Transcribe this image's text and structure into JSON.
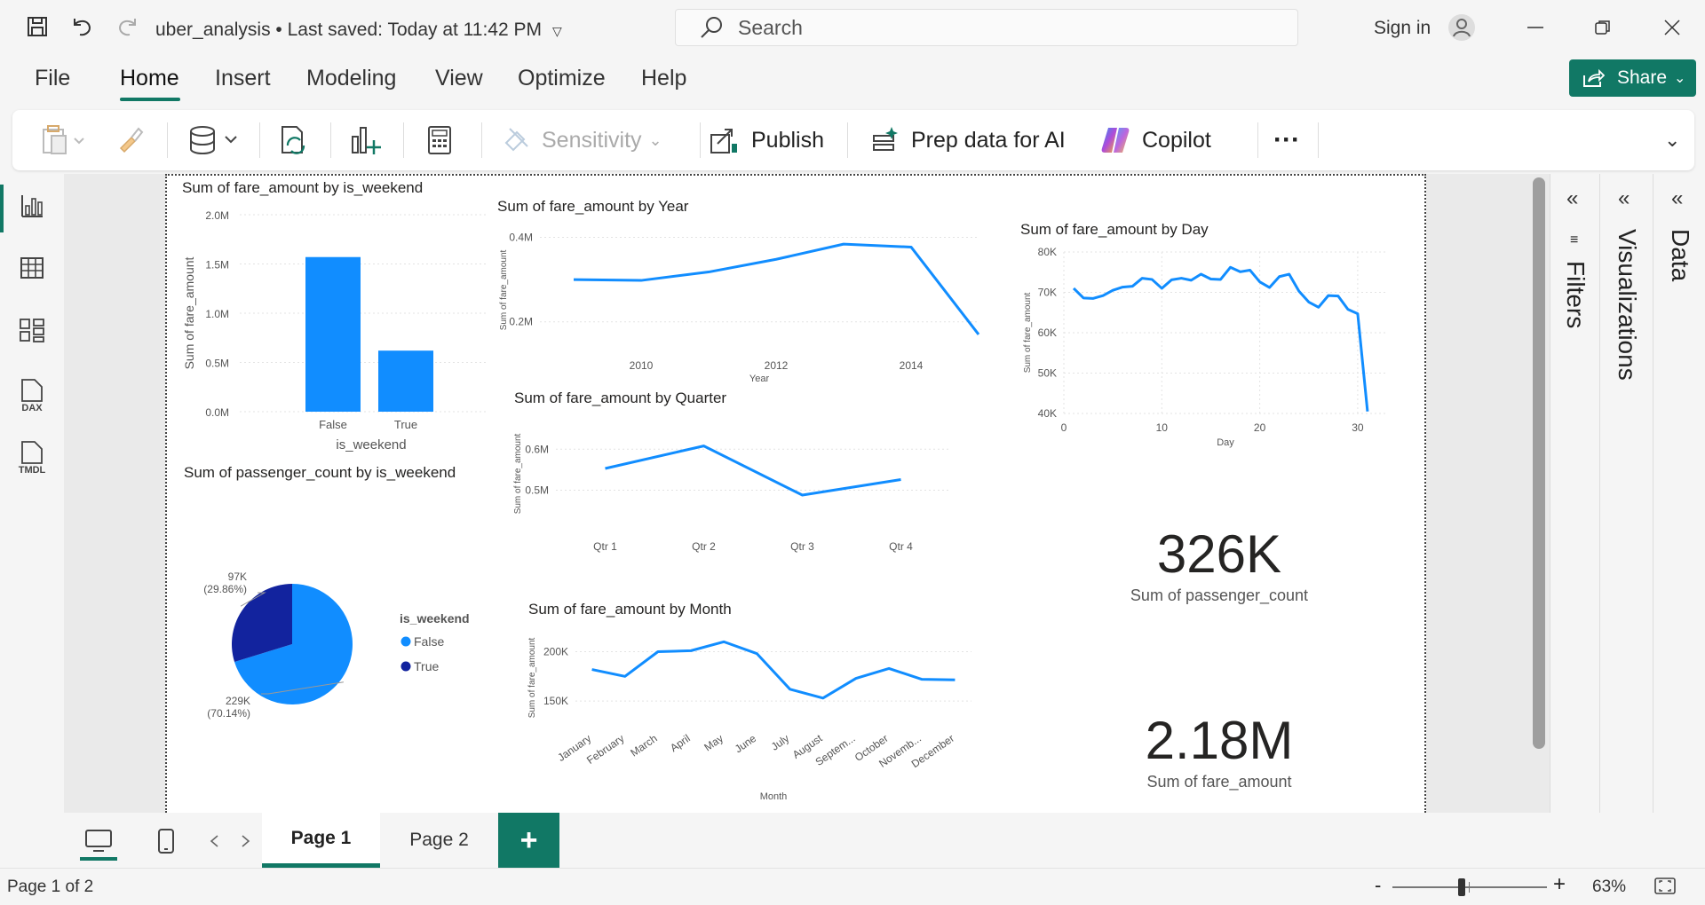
{
  "titlebar": {
    "doc_title": "uber_analysis • Last saved: Today at 11:42 PM",
    "search_placeholder": "Search",
    "signin": "Sign in"
  },
  "menu": [
    "File",
    "Home",
    "Insert",
    "Modeling",
    "View",
    "Optimize",
    "Help"
  ],
  "share_label": "Share",
  "ribbon": {
    "sensitivity": "Sensitivity",
    "publish": "Publish",
    "prep_ai": "Prep data for AI",
    "copilot": "Copilot",
    "more": "···"
  },
  "rail_icons": [
    "report-view-icon",
    "table-view-icon",
    "model-view-icon",
    "dax-query-icon",
    "tmdl-view-icon"
  ],
  "rail_labels": {
    "dax": "DAX",
    "tmdl": "TMDL"
  },
  "panes": {
    "filters": "Filters",
    "visualizations": "Visualizations",
    "data": "Data"
  },
  "tabs": [
    "Page 1",
    "Page 2"
  ],
  "add_tab": "+",
  "status": {
    "page_info": "Page 1 of 2",
    "zoom": "63%",
    "zoom_level": 0.45
  },
  "colors": {
    "accent": "#117865",
    "bar": "#118DFF",
    "dark_series": "#12239E"
  },
  "chart_data": [
    {
      "id": "bar_weekend",
      "type": "bar",
      "title": "Sum of fare_amount by is_weekend",
      "xlabel": "is_weekend",
      "ylabel": "Sum of fare_amount",
      "categories": [
        "False",
        "True"
      ],
      "values": [
        1570000,
        620000
      ],
      "ylim": [
        0,
        2000000
      ],
      "yticks": [
        0,
        500000,
        1000000,
        1500000,
        2000000
      ],
      "ytick_labels": [
        "0.0M",
        "0.5M",
        "1.0M",
        "1.5M",
        "2.0M"
      ]
    },
    {
      "id": "line_year",
      "type": "line",
      "title": "Sum of fare_amount by Year",
      "xlabel": "Year",
      "ylabel": "Sum of fare_amount",
      "x": [
        2009,
        2010,
        2011,
        2012,
        2013,
        2014,
        2015
      ],
      "values": [
        300000,
        298000,
        318000,
        348000,
        384000,
        377000,
        170000
      ],
      "xlim": [
        2008.5,
        2015
      ],
      "ylim": [
        130000,
        420000
      ],
      "xticks": [
        2010,
        2012,
        2014
      ],
      "yticks": [
        200000,
        400000
      ],
      "ytick_labels": [
        "0.2M",
        "0.4M"
      ]
    },
    {
      "id": "line_day",
      "type": "line",
      "title": "Sum of fare_amount by Day",
      "xlabel": "Day",
      "ylabel": "Sum of fare_amount",
      "x": [
        1,
        2,
        3,
        4,
        5,
        6,
        7,
        8,
        9,
        10,
        11,
        12,
        13,
        14,
        15,
        16,
        17,
        18,
        19,
        20,
        21,
        22,
        23,
        24,
        25,
        26,
        27,
        28,
        29,
        30,
        31
      ],
      "values": [
        71000,
        68600,
        68500,
        69200,
        70500,
        71300,
        71500,
        73500,
        73200,
        71000,
        73100,
        73500,
        73000,
        74500,
        73300,
        73200,
        76200,
        75100,
        75500,
        72600,
        71200,
        73900,
        74500,
        70300,
        67600,
        66300,
        69200,
        69100,
        65800,
        64700,
        40500
      ],
      "xlim": [
        0,
        33
      ],
      "ylim": [
        40000,
        80000
      ],
      "xticks": [
        0,
        10,
        20,
        30
      ],
      "yticks": [
        40000,
        50000,
        60000,
        70000,
        80000
      ],
      "ytick_labels": [
        "40K",
        "50K",
        "60K",
        "70K",
        "80K"
      ]
    },
    {
      "id": "line_quarter",
      "type": "line",
      "title": "Sum of fare_amount by Quarter",
      "xlabel": "",
      "ylabel": "Sum of fare_amount",
      "categories": [
        "Qtr 1",
        "Qtr 2",
        "Qtr 3",
        "Qtr 4"
      ],
      "values": [
        553000,
        608000,
        488000,
        526000
      ],
      "ylim": [
        410000,
        670000
      ],
      "yticks": [
        500000,
        600000
      ],
      "ytick_labels": [
        "0.5M",
        "0.6M"
      ]
    },
    {
      "id": "line_month",
      "type": "line",
      "title": "Sum of fare_amount by Month",
      "xlabel": "Month",
      "ylabel": "Sum of fare_amount",
      "categories": [
        "January",
        "February",
        "March",
        "April",
        "May",
        "June",
        "July",
        "August",
        "Septem...",
        "October",
        "Novemb...",
        "December"
      ],
      "values": [
        182000,
        175000,
        200000,
        201000,
        210000,
        198000,
        162000,
        153000,
        173000,
        183000,
        172000,
        171500
      ],
      "ylim": [
        125000,
        222000
      ],
      "yticks": [
        150000,
        200000
      ],
      "ytick_labels": [
        "150K",
        "200K"
      ]
    },
    {
      "id": "pie_weekend",
      "type": "pie",
      "title": "Sum of passenger_count by is_weekend",
      "legend_title": "is_weekend",
      "legend_position": "right",
      "slices": [
        {
          "name": "False",
          "value": 229000,
          "pct": 70.14,
          "label": "229K",
          "pct_label": "(70.14%)"
        },
        {
          "name": "True",
          "value": 97000,
          "pct": 29.86,
          "label": "97K",
          "pct_label": "(29.86%)"
        }
      ]
    }
  ],
  "cards": [
    {
      "value": "326K",
      "label": "Sum of passenger_count"
    },
    {
      "value": "2.18M",
      "label": "Sum of fare_amount"
    }
  ]
}
